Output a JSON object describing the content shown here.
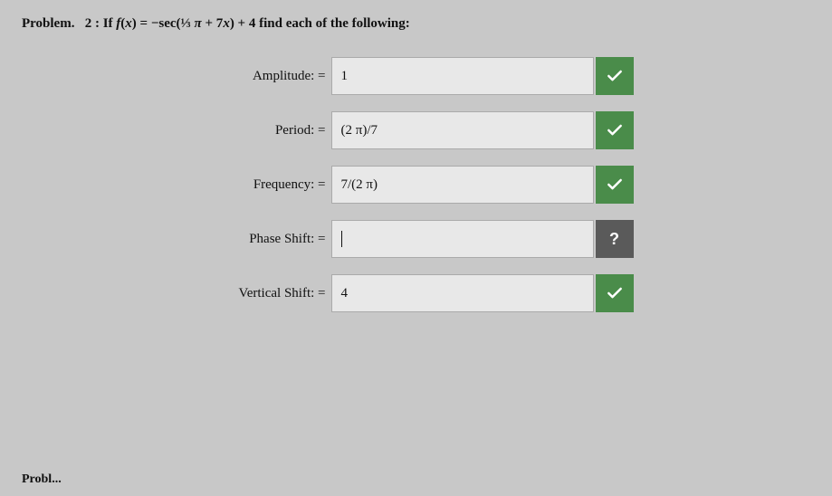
{
  "problem": {
    "label": "Problem.",
    "number": "2",
    "description": "If f(x) = −sec(⅟₃ π + 7x) + 4 find each of the following:"
  },
  "fields": [
    {
      "id": "amplitude",
      "label": "Amplitude: =",
      "value": "1",
      "type": "correct",
      "btn": "check"
    },
    {
      "id": "period",
      "label": "Period: =",
      "value": "(2 π)/7",
      "type": "correct",
      "btn": "check"
    },
    {
      "id": "frequency",
      "label": "Frequency: =",
      "value": "7/(2 π)",
      "type": "correct",
      "btn": "check"
    },
    {
      "id": "phase-shift",
      "label": "Phase Shift: =",
      "value": "",
      "cursor": true,
      "type": "unanswered",
      "btn": "question"
    },
    {
      "id": "vertical-shift",
      "label": "Vertical Shift: =",
      "value": "4",
      "type": "correct",
      "btn": "check"
    }
  ],
  "bottom_text": "Probl...",
  "icons": {
    "checkmark": "✓",
    "question": "?"
  }
}
